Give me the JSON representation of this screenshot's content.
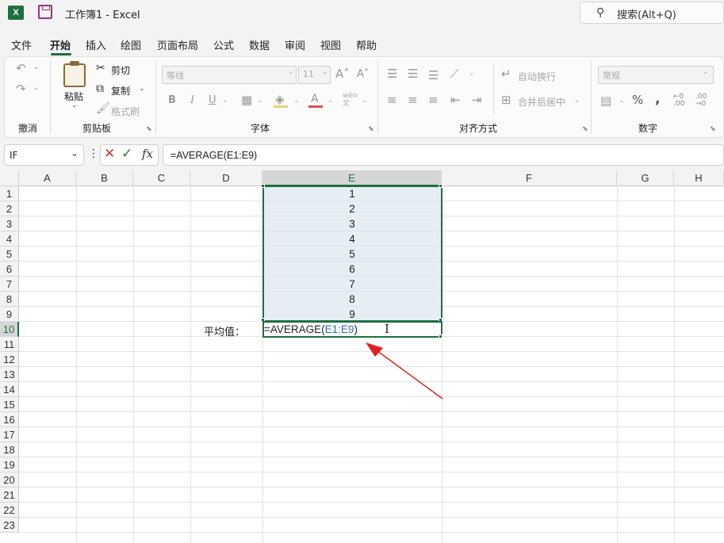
{
  "title_bar": {
    "app_icon": "X",
    "document_title": "工作簿1  -  Excel",
    "search_label": "搜索(Alt+Q)"
  },
  "menu": [
    "文件",
    "开始",
    "插入",
    "绘图",
    "页面布局",
    "公式",
    "数据",
    "审阅",
    "视图",
    "帮助"
  ],
  "ribbon": {
    "undo_group": "撤消",
    "clipboard": {
      "paste": "粘贴",
      "cut": "剪切",
      "copy": "复制",
      "format_painter": "格式刷",
      "group": "剪贴板"
    },
    "font": {
      "font_name": "等线",
      "font_size": "11",
      "bold": "B",
      "italic": "I",
      "underline": "U",
      "group": "字体"
    },
    "alignment": {
      "wrap": "自动换行",
      "merge": "合并后居中",
      "group": "对齐方式"
    },
    "number": {
      "format": "常规",
      "group": "数字"
    }
  },
  "formula_bar": {
    "name_box": "IF",
    "fx": "fx",
    "formula": "=AVERAGE(E1:E9)"
  },
  "columns": [
    "A",
    "B",
    "C",
    "D",
    "E",
    "F",
    "G",
    "H"
  ],
  "rows": [
    "1",
    "2",
    "3",
    "4",
    "5",
    "6",
    "7",
    "8",
    "9",
    "10",
    "11",
    "12",
    "13",
    "14",
    "15",
    "16",
    "17",
    "18",
    "19",
    "20",
    "21",
    "22",
    "23"
  ],
  "cells": {
    "e_values": [
      "1",
      "2",
      "3",
      "4",
      "5",
      "6",
      "7",
      "8",
      "9"
    ],
    "d10_label": "平均值：",
    "e10_prefix": "=AVERAGE(",
    "e10_ref": "E1:E9",
    "e10_suffix": ")"
  },
  "accent_color": "#1d6f42",
  "arrow_color": "#e02020"
}
